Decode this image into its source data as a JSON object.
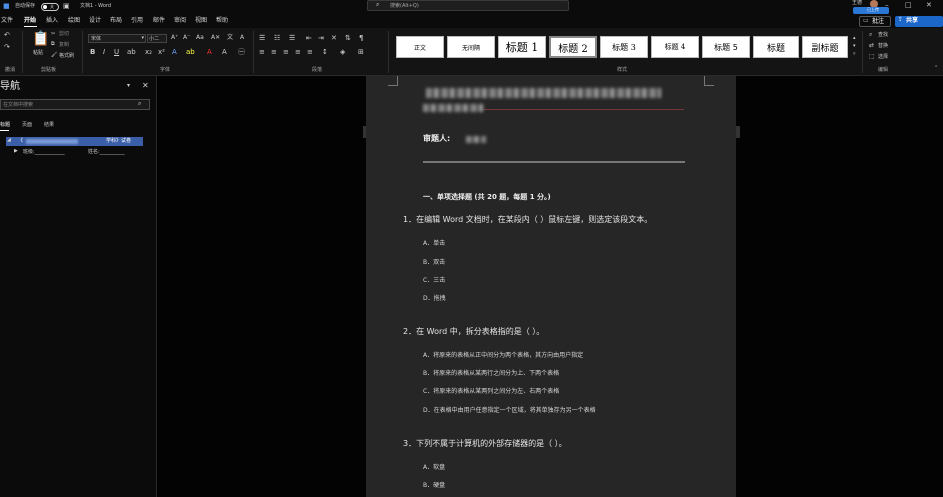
{
  "titlebar": {
    "autosave_label": "自动保存",
    "autosave_state": "关",
    "doc_title": "文档1 - Word",
    "search_placeholder": "搜索(Alt+Q)",
    "user": "王德",
    "upload_label": "已上传"
  },
  "tabs": [
    "文件",
    "开始",
    "插入",
    "绘图",
    "设计",
    "布局",
    "引用",
    "邮件",
    "审阅",
    "视图",
    "帮助"
  ],
  "right_buttons": {
    "comment": "批注",
    "share": "共享"
  },
  "ribbon": {
    "clipboard": {
      "paste": "粘贴",
      "cut": "剪切",
      "copy": "复制",
      "format_painter": "格式刷",
      "group": "剪贴板"
    },
    "undo_group": "撤消",
    "font": {
      "name": "宋体",
      "size": "小二",
      "group": "字体"
    },
    "paragraph_group": "段落",
    "styles_group": "样式",
    "styles": [
      "正文",
      "无间隔",
      "标题 1",
      "标题 2",
      "标题 3",
      "标题 4",
      "标题 5",
      "标题",
      "副标题"
    ],
    "editing": {
      "find": "查找",
      "replace": "替换",
      "select": "选择",
      "group": "编辑"
    }
  },
  "navpane": {
    "title": "导航",
    "search_placeholder": "在文档中搜索",
    "tabs": [
      "标题",
      "页面",
      "结果"
    ],
    "items": [
      {
        "label": "《",
        "label2": "学科》试卷"
      },
      {
        "label": "班级:____________",
        "label2": "姓名:__________"
      }
    ]
  },
  "document": {
    "reviewer": "审题人:",
    "section": "一、单项选择题 (共 20 题，每题 1 分。)",
    "questions": [
      {
        "stem": "1．在编辑 Word 文档时，在某段内（ ）鼠标左键，则选定该段文本。",
        "options": [
          "A．单击",
          "B．双击",
          "C．三击",
          "D．拖拽"
        ]
      },
      {
        "stem": "2．在 Word 中，拆分表格指的是（ ）。",
        "options": [
          "A．将原来的表格从正中间分为两个表格，其方向由用户指定",
          "B．将原来的表格从某两行之间分为上、下两个表格",
          "C．将原来的表格从某两列之间分为左、右两个表格",
          "D．在表格中由用户任意指定一个区域，将其单独存为另一个表格"
        ]
      },
      {
        "stem": "3．下列不属于计算机的外部存储器的是（ ）。",
        "options": [
          "A．软盘",
          "B．硬盘"
        ]
      }
    ]
  },
  "colors": {
    "accent": "#2b579a",
    "share": "#1b66c9"
  }
}
